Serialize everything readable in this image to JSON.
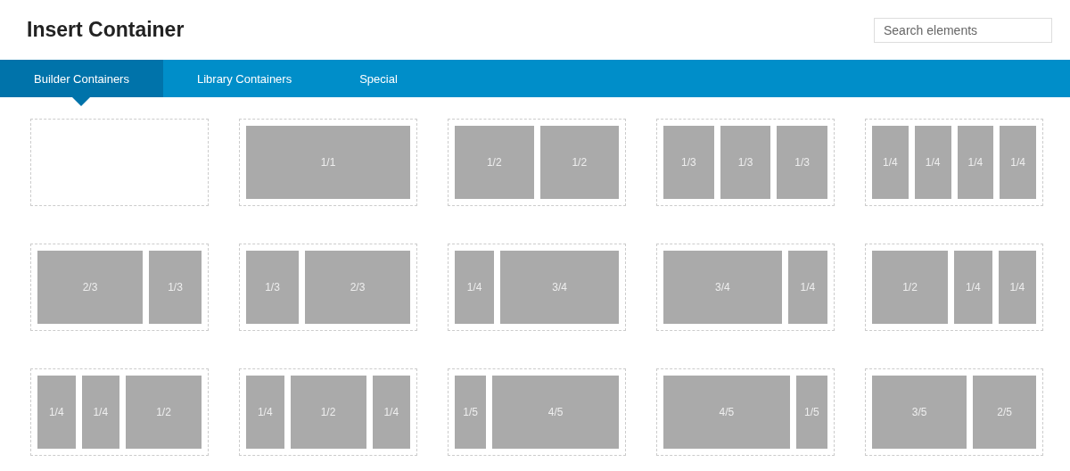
{
  "header": {
    "title": "Insert Container",
    "search": {
      "placeholder": "Search elements"
    }
  },
  "tabs": [
    {
      "label": "Builder Containers",
      "selected": true
    },
    {
      "label": "Library Containers",
      "selected": false
    },
    {
      "label": "Special",
      "selected": false
    }
  ],
  "containers": [
    {
      "kind": "blank"
    },
    {
      "kind": "columns",
      "columns": [
        "1/1"
      ]
    },
    {
      "kind": "columns",
      "columns": [
        "1/2",
        "1/2"
      ]
    },
    {
      "kind": "columns",
      "columns": [
        "1/3",
        "1/3",
        "1/3"
      ]
    },
    {
      "kind": "columns",
      "columns": [
        "1/4",
        "1/4",
        "1/4",
        "1/4"
      ]
    },
    {
      "kind": "columns",
      "columns": [
        "2/3",
        "1/3"
      ]
    },
    {
      "kind": "columns",
      "columns": [
        "1/3",
        "2/3"
      ]
    },
    {
      "kind": "columns",
      "columns": [
        "1/4",
        "3/4"
      ]
    },
    {
      "kind": "columns",
      "columns": [
        "3/4",
        "1/4"
      ]
    },
    {
      "kind": "columns",
      "columns": [
        "1/2",
        "1/4",
        "1/4"
      ]
    },
    {
      "kind": "columns",
      "columns": [
        "1/4",
        "1/4",
        "1/2"
      ]
    },
    {
      "kind": "columns",
      "columns": [
        "1/4",
        "1/2",
        "1/4"
      ]
    },
    {
      "kind": "columns",
      "columns": [
        "1/5",
        "4/5"
      ]
    },
    {
      "kind": "columns",
      "columns": [
        "4/5",
        "1/5"
      ]
    },
    {
      "kind": "columns",
      "columns": [
        "3/5",
        "2/5"
      ]
    }
  ]
}
